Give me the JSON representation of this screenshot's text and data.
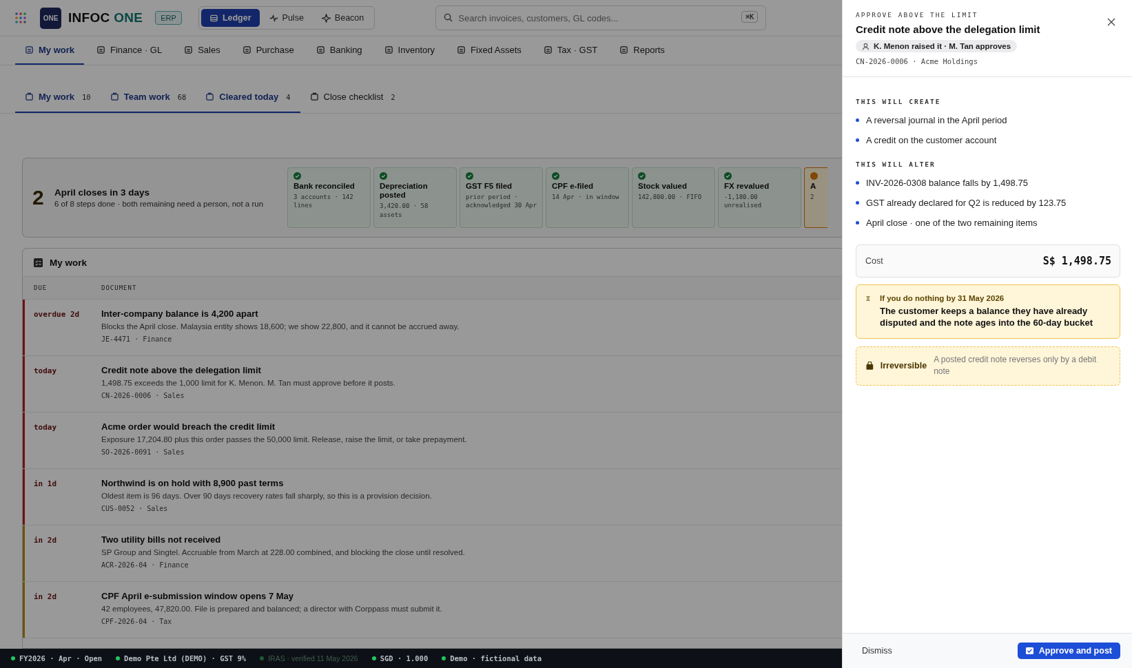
{
  "app": {
    "logo_mark": "ONE",
    "name": "INFOC",
    "name_accent": "ONE",
    "badge": "ERP"
  },
  "modes": [
    {
      "label": "Ledger",
      "selected": true
    },
    {
      "label": "Pulse",
      "selected": false
    },
    {
      "label": "Beacon",
      "selected": false
    }
  ],
  "search": {
    "placeholder": "Search invoices, customers, GL codes...",
    "shortcut": "⌘K"
  },
  "nav": [
    {
      "label": "My work",
      "selected": true
    },
    {
      "label": "Finance · GL",
      "selected": false
    },
    {
      "label": "Sales",
      "selected": false
    },
    {
      "label": "Purchase",
      "selected": false
    },
    {
      "label": "Banking",
      "selected": false
    },
    {
      "label": "Inventory",
      "selected": false
    },
    {
      "label": "Fixed Assets",
      "selected": false
    },
    {
      "label": "Tax · GST",
      "selected": false
    },
    {
      "label": "Reports",
      "selected": false
    }
  ],
  "work_tabs": [
    {
      "label": "My work",
      "count": "10",
      "selected": true
    },
    {
      "label": "Team work",
      "count": "68",
      "selected": true
    },
    {
      "label": "Cleared today",
      "count": "4",
      "selected": true
    },
    {
      "label": "Close checklist",
      "count": "2",
      "selected": false
    }
  ],
  "close_banner": {
    "number": "2",
    "title": "April closes in 3 days",
    "subtitle": "6 of 8 steps done · both remaining need a person, not a run",
    "steps": [
      {
        "title": "Bank reconciled",
        "detail": "3 accounts · 142 lines",
        "done": true
      },
      {
        "title": "Depreciation posted",
        "detail": "3,420.00 · 58 assets",
        "done": true
      },
      {
        "title": "GST F5 filed",
        "detail": "prior period · acknowledged 30 Apr",
        "done": true
      },
      {
        "title": "CPF e-filed",
        "detail": "14 Apr · in window",
        "done": true
      },
      {
        "title": "Stock valued",
        "detail": "142,800.00 · FIFO",
        "done": true
      },
      {
        "title": "FX revalued",
        "detail": "-1,180.00 unrealised",
        "done": true
      },
      {
        "title": "A",
        "detail": "2",
        "done": false
      }
    ]
  },
  "work_table": {
    "title": "My work",
    "columns": [
      "DUE",
      "DOCUMENT"
    ],
    "rows": [
      {
        "due": "overdue 2d",
        "title": "Inter-company balance is 4,200 apart",
        "text": "Blocks the April close. Malaysia entity shows 18,600; we show 22,800, and it cannot be accrued away.",
        "ref": "JE-4471 · Finance",
        "color": "#6f1111"
      },
      {
        "due": "today",
        "title": "Credit note above the delegation limit",
        "text": "1,498.75 exceeds the 1,000 limit for K. Menon. M. Tan must approve before it posts.",
        "ref": "CN-2026-0006 · Sales",
        "color": "#6f1111"
      },
      {
        "due": "today",
        "title": "Acme order would breach the credit limit",
        "text": "Exposure 17,204.80 plus this order passes the 50,000 limit. Release, raise the limit, or take prepayment.",
        "ref": "SO-2026-0091 · Sales",
        "color": "#6f1111"
      },
      {
        "due": "in 1d",
        "title": "Northwind is on hold with 8,900 past terms",
        "text": "Oldest item is 96 days. Over 90 days recovery rates fall sharply, so this is a provision decision.",
        "ref": "CUS-0052 · Sales",
        "color": "#6f1111"
      },
      {
        "due": "in 2d",
        "title": "Two utility bills not received",
        "text": "SP Group and Singtel. Accruable from March at 228.00 combined, and blocking the close until resolved.",
        "ref": "ACR-2026-04 · Finance",
        "color": "#6d5300"
      },
      {
        "due": "in 2d",
        "title": "CPF April e-submission window opens 7 May",
        "text": "42 employees, 47,820.00. File is prepared and balanced; a director with Corppass must submit it.",
        "ref": "CPF-2026-04 · Tax",
        "color": "#6d5300"
      }
    ]
  },
  "status_bar": [
    {
      "text": "FY2026 · Apr · Open",
      "muted": false
    },
    {
      "text": "Demo Pte Ltd (DEMO) · GST 9%",
      "muted": false
    },
    {
      "text": "IRAS · verified 11 May 2026",
      "muted": true
    },
    {
      "text": "SGD · 1.000",
      "muted": false
    },
    {
      "text": "Demo · fictional data",
      "muted": false
    }
  ],
  "panel": {
    "eyebrow": "APPROVE ABOVE THE LIMIT",
    "title": "Credit note above the delegation limit",
    "people": "K. Menon raised it · M. Tan approves",
    "ref": "CN-2026-0006 · Acme Holdings",
    "sections": [
      {
        "heading": "THIS WILL CREATE",
        "items": [
          "A reversal journal in the April period",
          "A credit on the customer account"
        ]
      },
      {
        "heading": "THIS WILL ALTER",
        "items": [
          "INV-2026-0308 balance falls by 1,498.75",
          "GST already declared for Q2 is reduced by 123.75",
          "April close · one of the two remaining items"
        ]
      }
    ],
    "cost": {
      "label": "Cost",
      "value": "S$ 1,498.75"
    },
    "warning": {
      "heading": "If you do nothing by 31 May 2026",
      "text": "The customer keeps a balance they have already disputed and the note ages into the 60-day bucket"
    },
    "irreversible": {
      "label": "Irreversible",
      "text": "A posted credit note reverses only by a debit note"
    },
    "dismiss": "Dismiss",
    "approve": "Approve and post"
  }
}
